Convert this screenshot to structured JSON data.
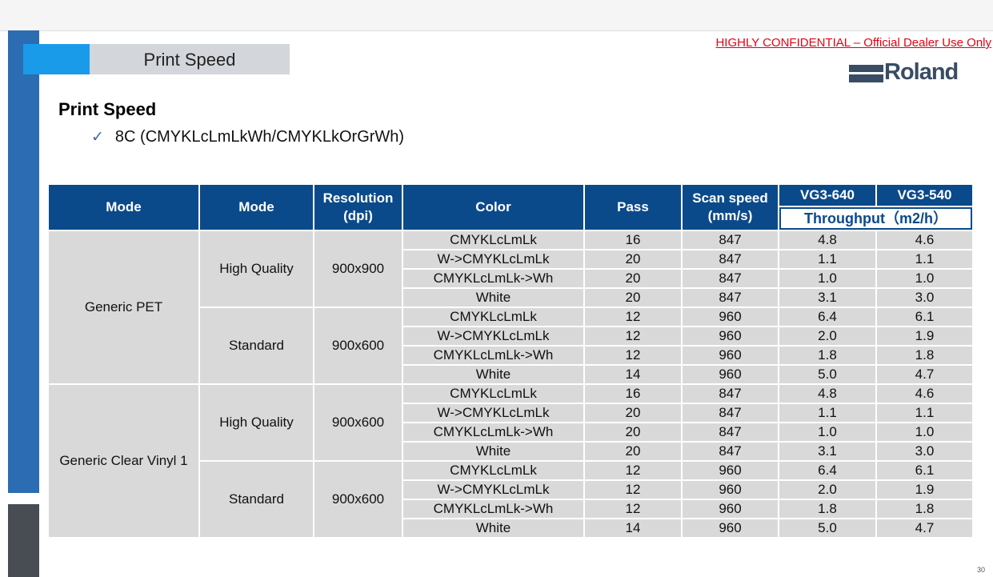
{
  "slide": {
    "title_tab": "Print Speed",
    "confidential": "HIGHLY CONFIDENTIAL – Official Dealer Use Only",
    "logo_text": "Roland",
    "heading": "Print Speed",
    "bullet_text": "8C (CMYKLcLmLkWh/CMYKLkOrGrWh)",
    "page_number": "30"
  },
  "table": {
    "headers": {
      "mode1": "Mode",
      "mode2": "Mode",
      "resolution": "Resolution",
      "resolution_unit": "(dpi)",
      "color": "Color",
      "pass": "Pass",
      "scan_speed": "Scan speed",
      "scan_speed_unit": "(mm/s)",
      "vg3_640": "VG3-640",
      "vg3_540": "VG3-540",
      "throughput": "Throughput（m2/h）"
    },
    "groups": [
      {
        "media": "Generic PET",
        "modes": [
          {
            "mode": "High Quality",
            "resolution": "900x900",
            "rows": [
              {
                "color": "CMYKLcLmLk",
                "pass": "16",
                "scan": "847",
                "vg640": "4.8",
                "vg540": "4.6"
              },
              {
                "color": "W->CMYKLcLmLk",
                "pass": "20",
                "scan": "847",
                "vg640": "1.1",
                "vg540": "1.1"
              },
              {
                "color": "CMYKLcLmLk->Wh",
                "pass": "20",
                "scan": "847",
                "vg640": "1.0",
                "vg540": "1.0"
              },
              {
                "color": "White",
                "pass": "20",
                "scan": "847",
                "vg640": "3.1",
                "vg540": "3.0"
              }
            ]
          },
          {
            "mode": "Standard",
            "resolution": "900x600",
            "rows": [
              {
                "color": "CMYKLcLmLk",
                "pass": "12",
                "scan": "960",
                "vg640": "6.4",
                "vg540": "6.1"
              },
              {
                "color": "W->CMYKLcLmLk",
                "pass": "12",
                "scan": "960",
                "vg640": "2.0",
                "vg540": "1.9"
              },
              {
                "color": "CMYKLcLmLk->Wh",
                "pass": "12",
                "scan": "960",
                "vg640": "1.8",
                "vg540": "1.8"
              },
              {
                "color": "White",
                "pass": "14",
                "scan": "960",
                "vg640": "5.0",
                "vg540": "4.7"
              }
            ]
          }
        ]
      },
      {
        "media": "Generic Clear Vinyl 1",
        "modes": [
          {
            "mode": "High Quality",
            "resolution": "900x600",
            "rows": [
              {
                "color": "CMYKLcLmLk",
                "pass": "16",
                "scan": "847",
                "vg640": "4.8",
                "vg540": "4.6"
              },
              {
                "color": "W->CMYKLcLmLk",
                "pass": "20",
                "scan": "847",
                "vg640": "1.1",
                "vg540": "1.1"
              },
              {
                "color": "CMYKLcLmLk->Wh",
                "pass": "20",
                "scan": "847",
                "vg640": "1.0",
                "vg540": "1.0"
              },
              {
                "color": "White",
                "pass": "20",
                "scan": "847",
                "vg640": "3.1",
                "vg540": "3.0"
              }
            ]
          },
          {
            "mode": "Standard",
            "resolution": "900x600",
            "rows": [
              {
                "color": "CMYKLcLmLk",
                "pass": "12",
                "scan": "960",
                "vg640": "6.4",
                "vg540": "6.1"
              },
              {
                "color": "W->CMYKLcLmLk",
                "pass": "12",
                "scan": "960",
                "vg640": "2.0",
                "vg540": "1.9"
              },
              {
                "color": "CMYKLcLmLk->Wh",
                "pass": "12",
                "scan": "960",
                "vg640": "1.8",
                "vg540": "1.8"
              },
              {
                "color": "White",
                "pass": "14",
                "scan": "960",
                "vg640": "5.0",
                "vg540": "4.7"
              }
            ]
          }
        ]
      }
    ]
  },
  "colors": {
    "header_bg": "#0b4a8a",
    "cell_bg": "#d9d9d9",
    "accent_blue": "#2b6cb3",
    "tab_accent": "#1a9bea",
    "confidential_red": "#e60012"
  }
}
